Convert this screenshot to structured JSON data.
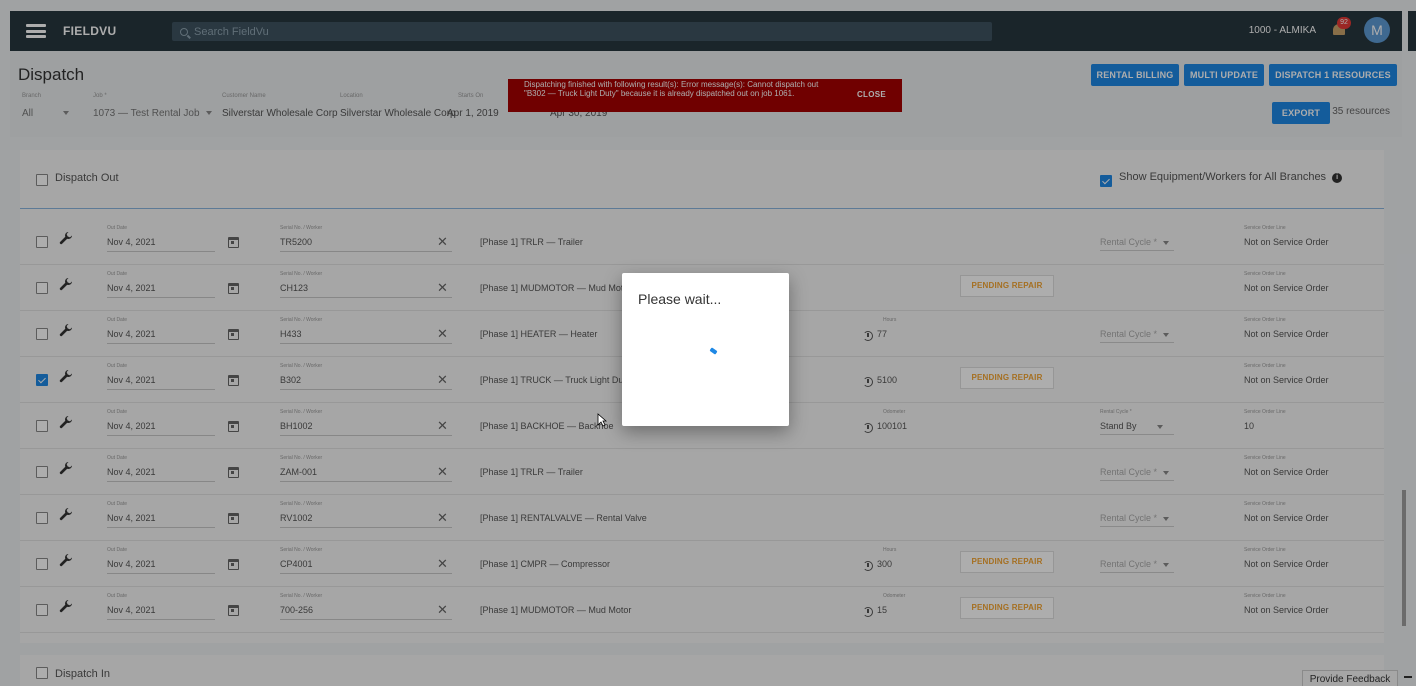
{
  "app": {
    "brand": "FIELDVU",
    "search_placeholder": "Search FieldVu",
    "company": "1000 - ALMIKA",
    "notification_count": "92",
    "avatar_initial": "M"
  },
  "header": {
    "title": "Dispatch",
    "filters": {
      "branch": {
        "label": "Branch",
        "value": "All"
      },
      "job": {
        "label": "Job *",
        "value": "1073 — Test Rental Job"
      },
      "customer": {
        "label": "Customer Name",
        "value": "Silverstar Wholesale Corp"
      },
      "location": {
        "label": "Location",
        "value": "Silverstar Wholesale Corp"
      },
      "starts_on": {
        "label": "Starts On",
        "value": "Apr 1, 2019"
      },
      "ends_on": {
        "value": "Apr 30, 2019"
      }
    },
    "buttons": {
      "rental_billing": "RENTAL BILLING",
      "multi_update": "MULTI UPDATE",
      "dispatch_resources": "DISPATCH 1 RESOURCES",
      "export": "EXPORT"
    },
    "resource_count": "35 resources"
  },
  "toast": {
    "message": "Dispatching finished with following result(s): Error message(s): Cannot dispatch out \"B302 — Truck Light Duty\" because it is already dispatched out on job 1061.",
    "close_label": "CLOSE"
  },
  "dispatch_out": {
    "title": "Dispatch Out",
    "show_all_label": "Show Equipment/Workers for All Branches",
    "show_all_checked": true,
    "labels": {
      "out_date": "Out Date",
      "serial": "Serial No. / Worker",
      "hours": "Hours",
      "odometer": "Odometer",
      "rental_cycle": "Rental Cycle *",
      "service_order_line": "Service Order Line",
      "pending_repair": "PENDING REPAIR"
    },
    "rows": [
      {
        "checked": false,
        "out_date": "Nov 4, 2021",
        "serial": "TR5200",
        "description": "[Phase 1] TRLR — Trailer",
        "meter_label": "",
        "meter_value": "",
        "pending": false,
        "rental_cycle": "Rental Cycle *",
        "rental_cycle_set": false,
        "service_order_line": "Not on Service Order"
      },
      {
        "checked": false,
        "out_date": "Nov 4, 2021",
        "serial": "CH123",
        "description": "[Phase 1] MUDMOTOR — Mud Motor",
        "meter_label": "",
        "meter_value": "",
        "pending": true,
        "rental_cycle": "",
        "rental_cycle_set": false,
        "service_order_line": "Not on Service Order"
      },
      {
        "checked": false,
        "out_date": "Nov 4, 2021",
        "serial": "H433",
        "description": "[Phase 1] HEATER — Heater",
        "meter_label": "Hours",
        "meter_value": "77",
        "pending": false,
        "rental_cycle": "Rental Cycle *",
        "rental_cycle_set": false,
        "service_order_line": "Not on Service Order"
      },
      {
        "checked": true,
        "out_date": "Nov 4, 2021",
        "serial": "B302",
        "description": "[Phase 1] TRUCK — Truck Light Duty",
        "meter_label": "",
        "meter_value": "5100",
        "pending": true,
        "rental_cycle": "",
        "rental_cycle_set": false,
        "service_order_line": "Not on Service Order"
      },
      {
        "checked": false,
        "out_date": "Nov 4, 2021",
        "serial": "BH1002",
        "description": "[Phase 1] BACKHOE — Backhoe",
        "meter_label": "Odometer",
        "meter_value": "100101",
        "pending": false,
        "rental_cycle": "Stand By",
        "rental_cycle_set": true,
        "service_order_line": "10"
      },
      {
        "checked": false,
        "out_date": "Nov 4, 2021",
        "serial": "ZAM-001",
        "description": "[Phase 1] TRLR — Trailer",
        "meter_label": "",
        "meter_value": "",
        "pending": false,
        "rental_cycle": "Rental Cycle *",
        "rental_cycle_set": false,
        "service_order_line": "Not on Service Order"
      },
      {
        "checked": false,
        "out_date": "Nov 4, 2021",
        "serial": "RV1002",
        "description": "[Phase 1] RENTALVALVE — Rental Valve",
        "meter_label": "",
        "meter_value": "",
        "pending": false,
        "rental_cycle": "Rental Cycle *",
        "rental_cycle_set": false,
        "service_order_line": "Not on Service Order"
      },
      {
        "checked": false,
        "out_date": "Nov 4, 2021",
        "serial": "CP4001",
        "description": "[Phase 1] CMPR — Compressor",
        "meter_label": "Hours",
        "meter_value": "300",
        "pending": true,
        "rental_cycle": "Rental Cycle *",
        "rental_cycle_set": false,
        "service_order_line": "Not on Service Order"
      },
      {
        "checked": false,
        "out_date": "Nov 4, 2021",
        "serial": "700-256",
        "description": "[Phase 1] MUDMOTOR — Mud Motor",
        "meter_label": "Odometer",
        "meter_value": "15",
        "pending": true,
        "rental_cycle": "",
        "rental_cycle_set": false,
        "service_order_line": "Not on Service Order"
      }
    ]
  },
  "dispatch_in": {
    "title": "Dispatch In"
  },
  "feedback_label": "Provide Feedback",
  "dialog": {
    "title": "Please wait..."
  }
}
